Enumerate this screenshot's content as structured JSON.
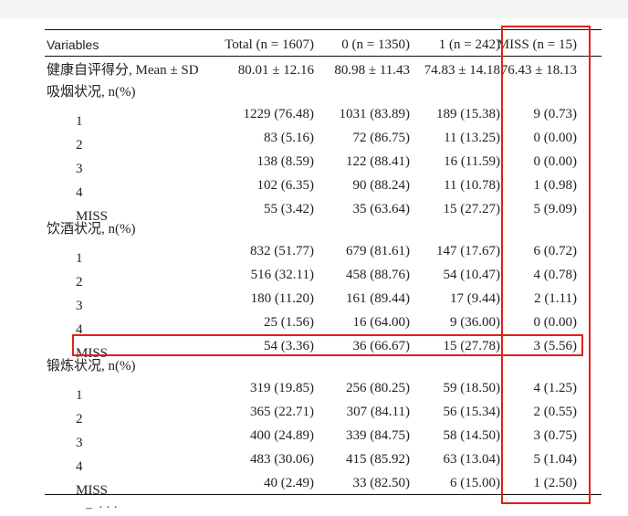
{
  "table": {
    "headers": [
      "Variables",
      "Total (n = 1607)",
      "0 (n = 1350)",
      "1 (n = 242)",
      "MISS (n = 15)"
    ],
    "rows": [
      {
        "label": "健康自评得分, Mean ± SD",
        "indent": false,
        "cells": [
          "80.01 ± 12.16",
          "80.98 ± 11.43",
          "74.83 ± 14.18",
          "76.43 ± 18.13"
        ]
      },
      {
        "label": "吸烟状况, n(%)",
        "indent": false,
        "cells": [
          "",
          "",
          "",
          ""
        ]
      },
      {
        "label": "1",
        "indent": true,
        "cells": [
          "1229 (76.48)",
          "1031 (83.89)",
          "189 (15.38)",
          "9 (0.73)"
        ]
      },
      {
        "label": "2",
        "indent": true,
        "cells": [
          "83 (5.16)",
          "72 (86.75)",
          "11 (13.25)",
          "0 (0.00)"
        ]
      },
      {
        "label": "3",
        "indent": true,
        "cells": [
          "138 (8.59)",
          "122 (88.41)",
          "16 (11.59)",
          "0 (0.00)"
        ]
      },
      {
        "label": "4",
        "indent": true,
        "cells": [
          "102 (6.35)",
          "90 (88.24)",
          "11 (10.78)",
          "1 (0.98)"
        ]
      },
      {
        "label": "MISS",
        "indent": true,
        "cells": [
          "55 (3.42)",
          "35 (63.64)",
          "15 (27.27)",
          "5 (9.09)"
        ]
      },
      {
        "label": "饮酒状况, n(%)",
        "indent": false,
        "cells": [
          "",
          "",
          "",
          ""
        ]
      },
      {
        "label": "1",
        "indent": true,
        "cells": [
          "832 (51.77)",
          "679 (81.61)",
          "147 (17.67)",
          "6 (0.72)"
        ]
      },
      {
        "label": "2",
        "indent": true,
        "cells": [
          "516 (32.11)",
          "458 (88.76)",
          "54 (10.47)",
          "4 (0.78)"
        ]
      },
      {
        "label": "3",
        "indent": true,
        "cells": [
          "180 (11.20)",
          "161 (89.44)",
          "17 (9.44)",
          "2 (1.11)"
        ]
      },
      {
        "label": "4",
        "indent": true,
        "cells": [
          "25 (1.56)",
          "16 (64.00)",
          "9 (36.00)",
          "0 (0.00)"
        ]
      },
      {
        "label": "MISS",
        "indent": true,
        "cells": [
          "54 (3.36)",
          "36 (66.67)",
          "15 (27.78)",
          "3 (5.56)"
        ]
      },
      {
        "label": "锻炼状况, n(%)",
        "indent": false,
        "cells": [
          "",
          "",
          "",
          ""
        ]
      },
      {
        "label": "1",
        "indent": true,
        "cells": [
          "319 (19.85)",
          "256 (80.25)",
          "59 (18.50)",
          "4 (1.25)"
        ]
      },
      {
        "label": "2",
        "indent": true,
        "cells": [
          "365 (22.71)",
          "307 (84.11)",
          "56 (15.34)",
          "2 (0.55)"
        ]
      },
      {
        "label": "3",
        "indent": true,
        "cells": [
          "400 (24.89)",
          "339 (84.75)",
          "58 (14.50)",
          "3 (0.75)"
        ]
      },
      {
        "label": "4",
        "indent": true,
        "cells": [
          "483 (30.06)",
          "415 (85.92)",
          "63 (13.04)",
          "5 (1.04)"
        ]
      },
      {
        "label": "MISS",
        "indent": true,
        "cells": [
          "40 (2.49)",
          "33 (82.50)",
          "6 (15.00)",
          "1 (2.50)"
        ]
      }
    ]
  },
  "colors": {
    "highlight": "#e0201a",
    "rule": "#111111",
    "topbar": "#f3f3f4"
  }
}
